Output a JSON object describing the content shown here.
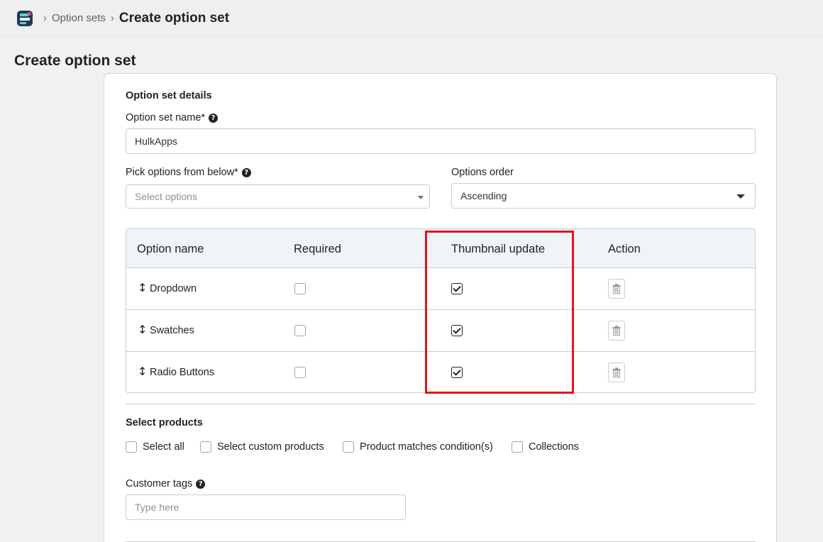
{
  "breadcrumb": {
    "parent": "Option sets",
    "current": "Create option set",
    "separator": "›"
  },
  "page": {
    "title": "Create option set"
  },
  "details": {
    "section_title": "Option set details",
    "name_label": "Option set name*",
    "name_value": "HulkApps",
    "pick_label": "Pick options from below*",
    "pick_placeholder": "Select options",
    "order_label": "Options order",
    "order_value": "Ascending"
  },
  "table": {
    "headers": [
      "Option name",
      "Required",
      "Thumbnail update",
      "Action"
    ],
    "rows": [
      {
        "name": "Dropdown",
        "required": false,
        "thumbnail_update": true
      },
      {
        "name": "Swatches",
        "required": false,
        "thumbnail_update": true
      },
      {
        "name": "Radio Buttons",
        "required": false,
        "thumbnail_update": true
      }
    ]
  },
  "products": {
    "section_title": "Select products",
    "options": [
      "Select all",
      "Select custom products",
      "Product matches condition(s)",
      "Collections"
    ]
  },
  "customer_tags": {
    "label": "Customer tags",
    "placeholder": "Type here"
  },
  "colors": {
    "highlight": "#e2141c",
    "header_bg": "#f1f4f7"
  }
}
